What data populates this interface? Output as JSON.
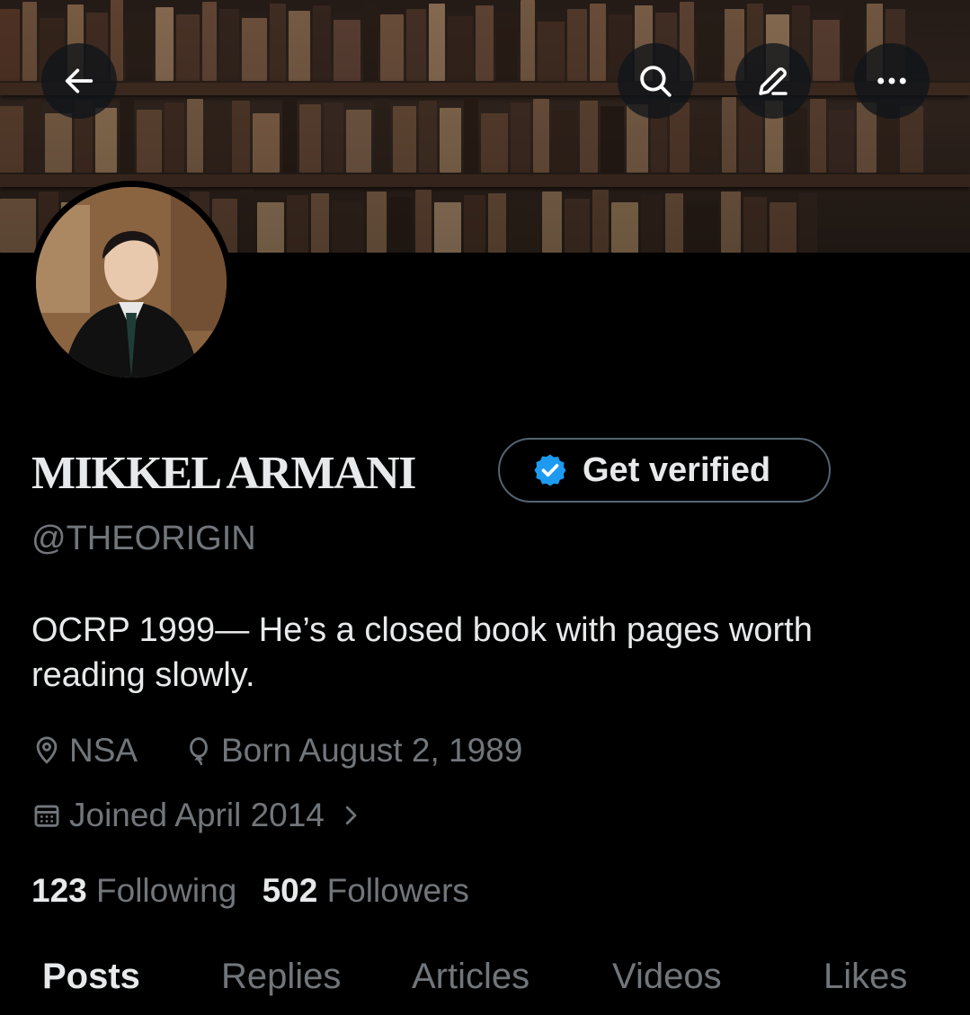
{
  "header": {
    "back_icon": "arrow-left-icon",
    "search_icon": "search-icon",
    "edit_icon": "pencil-icon",
    "more_icon": "more-horizontal-icon"
  },
  "profile": {
    "display_name": "MIKKEL ARMANI",
    "handle": "@THEORIGIN",
    "verify_button_label": "Get verified",
    "bio_line1": "OCRP 1999— He’s a closed book with pages worth",
    "bio_line2": "reading slowly.",
    "location": "NSA",
    "birthday": "Born August 2, 1989",
    "joined": "Joined April 2014",
    "following_count": "123",
    "following_label": "Following",
    "followers_count": "502",
    "followers_label": "Followers"
  },
  "tabs": [
    {
      "label": "Posts",
      "active": true
    },
    {
      "label": "Replies",
      "active": false
    },
    {
      "label": "Articles",
      "active": false
    },
    {
      "label": "Videos",
      "active": false
    },
    {
      "label": "Likes",
      "active": false
    }
  ],
  "colors": {
    "background": "#000000",
    "text_primary": "#e7e9ea",
    "text_secondary": "#71767b",
    "verified_blue": "#1d9bf0",
    "border": "#536471"
  }
}
